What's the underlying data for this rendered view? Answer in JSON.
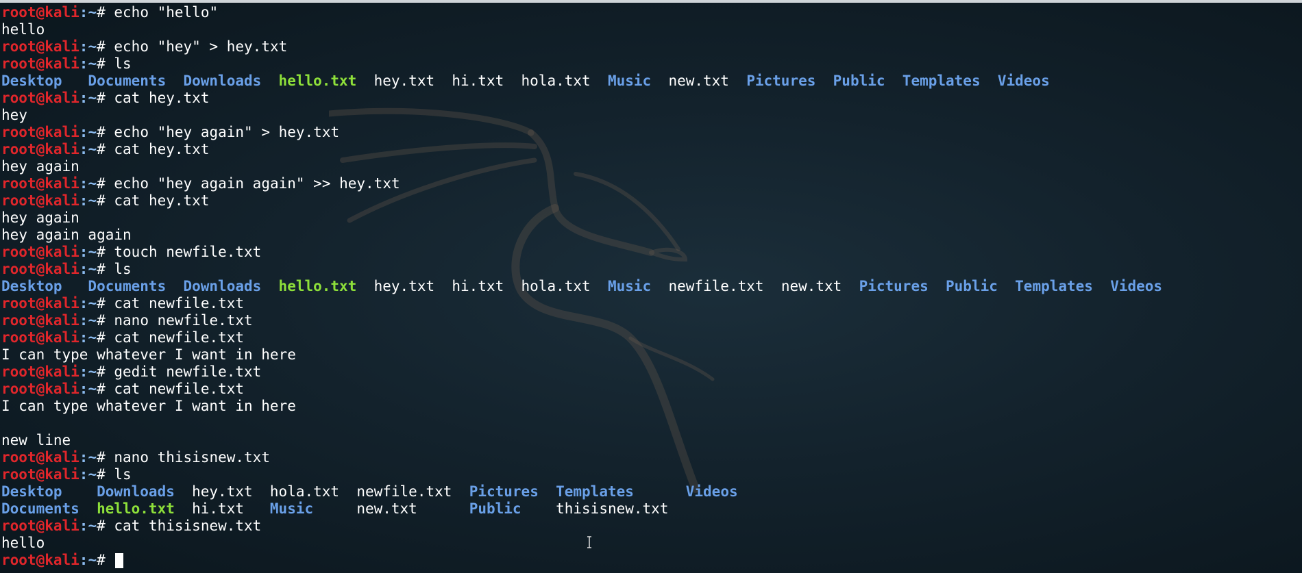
{
  "prompt": {
    "user": "root@kali",
    "path": ":~",
    "hash": "# "
  },
  "lines": [
    {
      "kind": "prompt",
      "cmd": "echo \"hello\""
    },
    {
      "kind": "out",
      "text": "hello"
    },
    {
      "kind": "prompt",
      "cmd": "echo \"hey\" > hey.txt"
    },
    {
      "kind": "prompt",
      "cmd": "ls"
    },
    {
      "kind": "ls",
      "items": [
        {
          "t": "Desktop",
          "c": "dir",
          "w": 10
        },
        {
          "t": "Documents",
          "c": "dir",
          "w": 11
        },
        {
          "t": "Downloads",
          "c": "dir",
          "w": 11
        },
        {
          "t": "hello.txt",
          "c": "exec",
          "w": 11
        },
        {
          "t": "hey.txt",
          "c": "file",
          "w": 9
        },
        {
          "t": "hi.txt",
          "c": "file",
          "w": 8
        },
        {
          "t": "hola.txt",
          "c": "file",
          "w": 10
        },
        {
          "t": "Music",
          "c": "dir",
          "w": 7
        },
        {
          "t": "new.txt",
          "c": "file",
          "w": 9
        },
        {
          "t": "Pictures",
          "c": "dir",
          "w": 10
        },
        {
          "t": "Public",
          "c": "dir",
          "w": 8
        },
        {
          "t": "Templates",
          "c": "dir",
          "w": 11
        },
        {
          "t": "Videos",
          "c": "dir",
          "w": 6
        }
      ]
    },
    {
      "kind": "prompt",
      "cmd": "cat hey.txt"
    },
    {
      "kind": "out",
      "text": "hey"
    },
    {
      "kind": "prompt",
      "cmd": "echo \"hey again\" > hey.txt"
    },
    {
      "kind": "prompt",
      "cmd": "cat hey.txt"
    },
    {
      "kind": "out",
      "text": "hey again"
    },
    {
      "kind": "prompt",
      "cmd": "echo \"hey again again\" >> hey.txt"
    },
    {
      "kind": "prompt",
      "cmd": "cat hey.txt"
    },
    {
      "kind": "out",
      "text": "hey again"
    },
    {
      "kind": "out",
      "text": "hey again again"
    },
    {
      "kind": "prompt",
      "cmd": "touch newfile.txt"
    },
    {
      "kind": "prompt",
      "cmd": "ls"
    },
    {
      "kind": "ls",
      "items": [
        {
          "t": "Desktop",
          "c": "dir",
          "w": 10
        },
        {
          "t": "Documents",
          "c": "dir",
          "w": 11
        },
        {
          "t": "Downloads",
          "c": "dir",
          "w": 11
        },
        {
          "t": "hello.txt",
          "c": "exec",
          "w": 11
        },
        {
          "t": "hey.txt",
          "c": "file",
          "w": 9
        },
        {
          "t": "hi.txt",
          "c": "file",
          "w": 8
        },
        {
          "t": "hola.txt",
          "c": "file",
          "w": 10
        },
        {
          "t": "Music",
          "c": "dir",
          "w": 7
        },
        {
          "t": "newfile.txt",
          "c": "file",
          "w": 13
        },
        {
          "t": "new.txt",
          "c": "file",
          "w": 9
        },
        {
          "t": "Pictures",
          "c": "dir",
          "w": 10
        },
        {
          "t": "Public",
          "c": "dir",
          "w": 8
        },
        {
          "t": "Templates",
          "c": "dir",
          "w": 11
        },
        {
          "t": "Videos",
          "c": "dir",
          "w": 6
        }
      ]
    },
    {
      "kind": "prompt",
      "cmd": "cat newfile.txt"
    },
    {
      "kind": "prompt",
      "cmd": "nano newfile.txt"
    },
    {
      "kind": "prompt",
      "cmd": "cat newfile.txt"
    },
    {
      "kind": "out",
      "text": "I can type whatever I want in here"
    },
    {
      "kind": "prompt",
      "cmd": "gedit newfile.txt"
    },
    {
      "kind": "prompt",
      "cmd": "cat newfile.txt"
    },
    {
      "kind": "out",
      "text": "I can type whatever I want in here"
    },
    {
      "kind": "out",
      "text": ""
    },
    {
      "kind": "out",
      "text": "new line"
    },
    {
      "kind": "prompt",
      "cmd": "nano thisisnew.txt"
    },
    {
      "kind": "prompt",
      "cmd": "ls"
    },
    {
      "kind": "ls",
      "items": [
        {
          "t": "Desktop",
          "c": "dir",
          "w": 11
        },
        {
          "t": "Downloads",
          "c": "dir",
          "w": 11
        },
        {
          "t": "hey.txt",
          "c": "file",
          "w": 9
        },
        {
          "t": "hola.txt",
          "c": "file",
          "w": 10
        },
        {
          "t": "newfile.txt",
          "c": "file",
          "w": 13
        },
        {
          "t": "Pictures",
          "c": "dir",
          "w": 10
        },
        {
          "t": "Templates",
          "c": "dir",
          "w": 15
        },
        {
          "t": "Videos",
          "c": "dir",
          "w": 6
        }
      ]
    },
    {
      "kind": "ls",
      "items": [
        {
          "t": "Documents",
          "c": "dir",
          "w": 11
        },
        {
          "t": "hello.txt",
          "c": "exec",
          "w": 11
        },
        {
          "t": "hi.txt",
          "c": "file",
          "w": 9
        },
        {
          "t": "Music",
          "c": "dir",
          "w": 10
        },
        {
          "t": "new.txt",
          "c": "file",
          "w": 13
        },
        {
          "t": "Public",
          "c": "dir",
          "w": 10
        },
        {
          "t": "thisisnew.txt",
          "c": "file",
          "w": 13
        }
      ]
    },
    {
      "kind": "prompt",
      "cmd": "cat thisisnew.txt"
    },
    {
      "kind": "out",
      "text": "hello"
    },
    {
      "kind": "prompt",
      "cmd": "",
      "cursor": true
    }
  ]
}
